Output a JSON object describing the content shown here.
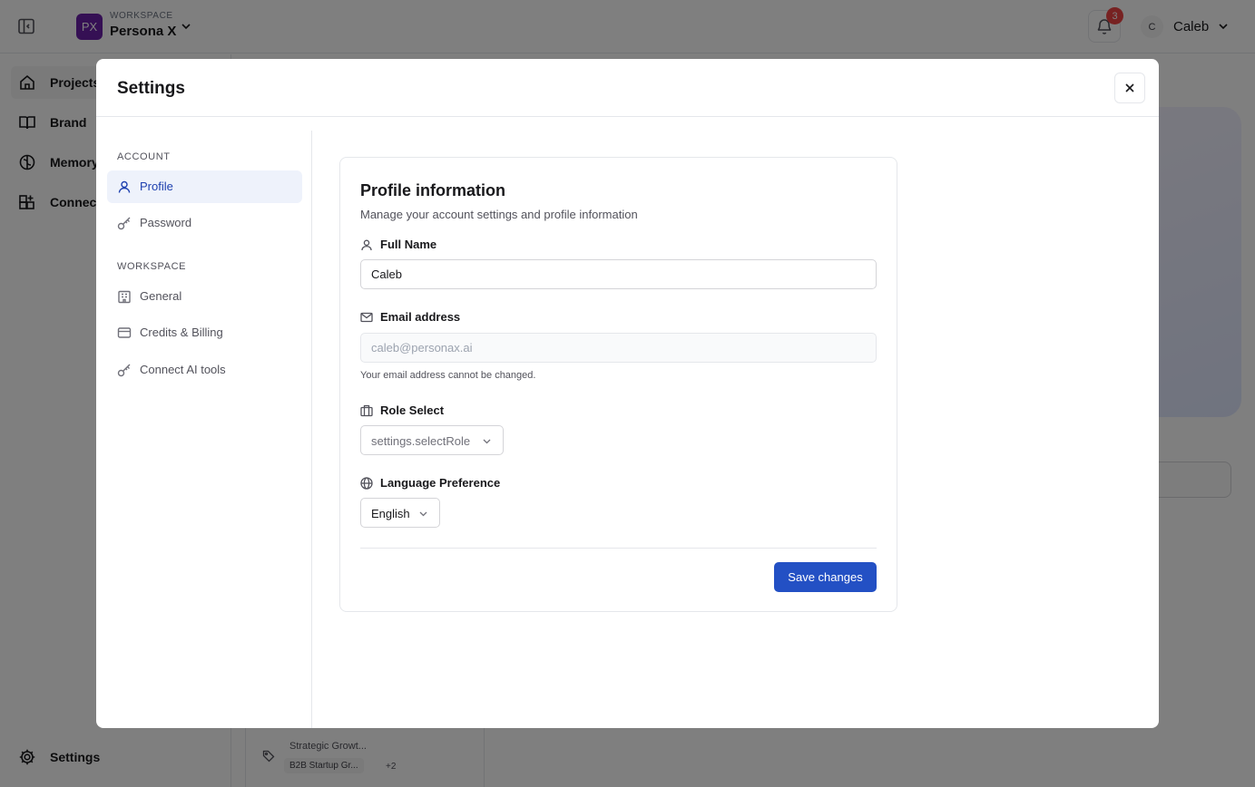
{
  "topbar": {
    "workspace_caption": "WORKSPACE",
    "workspace_initials": "PX",
    "workspace_name": "Persona X",
    "notification_count": "3",
    "user_initial": "C",
    "user_name": "Caleb"
  },
  "background_sidebar": {
    "items": [
      {
        "label": "Projects",
        "icon": "home-icon"
      },
      {
        "label": "Brand",
        "icon": "book-icon"
      },
      {
        "label": "Memory",
        "icon": "brain-icon"
      },
      {
        "label": "Connect",
        "icon": "grid-plus-icon"
      }
    ],
    "settings_label": "Settings"
  },
  "background_content": {
    "tag_title": "Strategic Growt...",
    "tag_chip": "B2B Startup Gr...",
    "tag_more": "+2"
  },
  "modal": {
    "title": "Settings",
    "nav": {
      "account_section": "ACCOUNT",
      "workspace_section": "WORKSPACE",
      "items": [
        {
          "label": "Profile",
          "icon": "user-icon"
        },
        {
          "label": "Password",
          "icon": "key-icon"
        },
        {
          "label": "General",
          "icon": "building-icon"
        },
        {
          "label": "Credits & Billing",
          "icon": "credit-card-icon"
        },
        {
          "label": "Connect AI tools",
          "icon": "key-icon"
        }
      ]
    },
    "profile": {
      "title": "Profile information",
      "subtitle": "Manage your account settings and profile information",
      "full_name_label": "Full Name",
      "full_name_value": "Caleb",
      "email_label": "Email address",
      "email_value": "caleb@personax.ai",
      "email_helper": "Your email address cannot be changed.",
      "role_label": "Role Select",
      "role_value": "settings.selectRole",
      "language_label": "Language Preference",
      "language_value": "English",
      "save_label": "Save changes"
    }
  },
  "colors": {
    "accent": "#2350c4",
    "active_nav_bg": "#eef2fb",
    "workspace_avatar": "#6b21a8",
    "badge": "#ef4444"
  }
}
